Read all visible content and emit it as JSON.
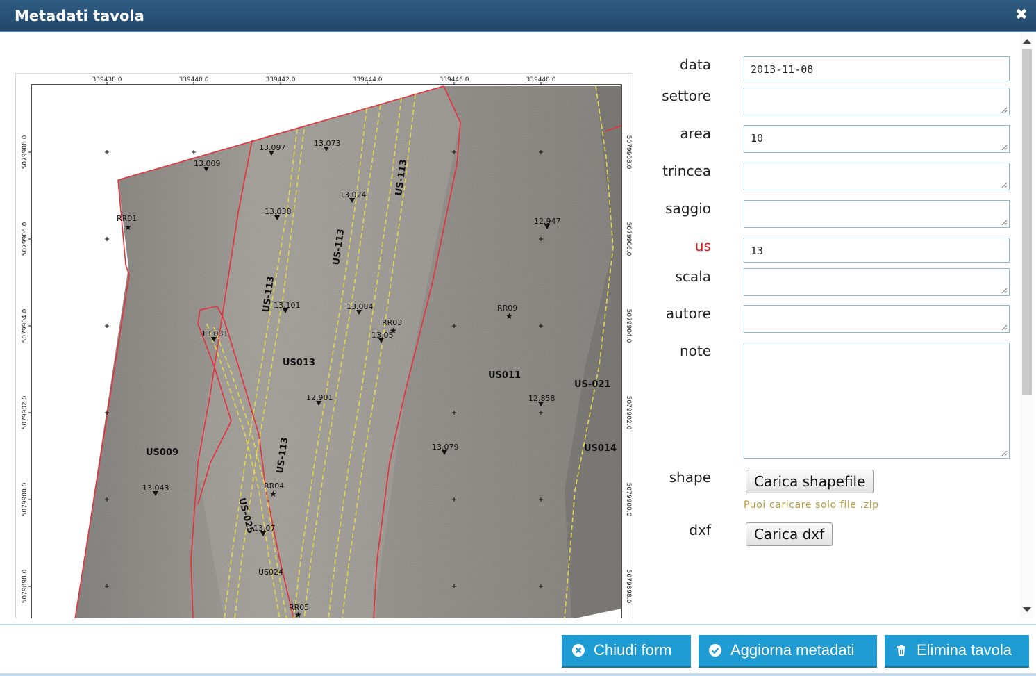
{
  "dialog": {
    "title": "Metadati tavola",
    "close_icon": "close-icon"
  },
  "map": {
    "x_ticks": [
      "339438.0",
      "339440.0",
      "339442.0",
      "339444.0",
      "339446.0",
      "339448.0"
    ],
    "y_ticks": [
      "5079908.0",
      "5079906.0",
      "5079904.0",
      "5079902.0",
      "5079900.0",
      "5079898.0"
    ],
    "spot_heights": [
      "13.009",
      "13.097",
      "13.073",
      "13.024",
      "13.038",
      "12.947",
      "13.101",
      "13.084",
      "13.05",
      "13.031",
      "12.981",
      "12.858",
      "13.079",
      "13.043",
      "13.07"
    ],
    "points": [
      "RR01",
      "RR03",
      "RR09",
      "RR04",
      "RR05"
    ],
    "units": [
      "US013",
      "US011",
      "US009",
      "US014",
      "US024"
    ],
    "line_labels": [
      "US-113",
      "US-113",
      "US-113",
      "US-113",
      "US-021",
      "US-025"
    ]
  },
  "form": {
    "fields": [
      {
        "label": "data",
        "value": "2013-11-08"
      },
      {
        "label": "settore",
        "value": ""
      },
      {
        "label": "area",
        "value": "10"
      },
      {
        "label": "trincea",
        "value": ""
      },
      {
        "label": "saggio",
        "value": ""
      },
      {
        "label": "us",
        "value": "13"
      },
      {
        "label": "scala",
        "value": ""
      },
      {
        "label": "autore",
        "value": ""
      },
      {
        "label": "note",
        "value": ""
      }
    ],
    "shape_label": "shape",
    "shape_button": "Carica shapefile",
    "shape_hint": "Puoi caricare solo file .zip",
    "dxf_label": "dxf",
    "dxf_button": "Carica dxf"
  },
  "footer": {
    "close_button": "Chiudi form",
    "update_button": "Aggiorna metadati",
    "delete_button": "Elimina tavola"
  },
  "colors": {
    "titlebar": "#22486b",
    "button": "#1e9bd2",
    "required": "#e01a1a",
    "field_border": "#8fb8d8",
    "hint": "#b79a3a",
    "polygon_red": "#e8303a",
    "line_yellow": "#e3d64a"
  }
}
